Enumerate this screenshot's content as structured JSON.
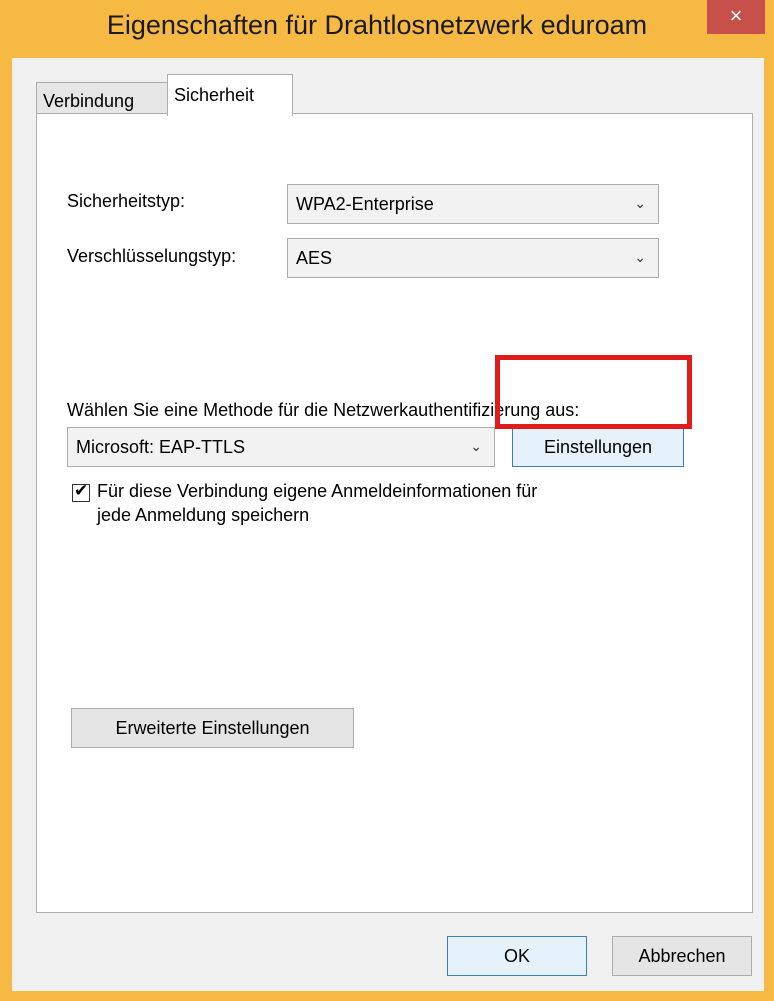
{
  "window": {
    "title": "Eigenschaften für Drahtlosnetzwerk eduroam",
    "close_label": "×"
  },
  "tabs": [
    {
      "label": "Verbindung",
      "active": false
    },
    {
      "label": "Sicherheit",
      "active": true
    }
  ],
  "security": {
    "type_label": "Sicherheitstyp:",
    "type_value": "WPA2-Enterprise",
    "encryption_label": "Verschlüsselungstyp:",
    "encryption_value": "AES"
  },
  "auth": {
    "method_label": "Wählen Sie eine Methode für die Netzwerkauthentifizierung aus:",
    "method_value": "Microsoft: EAP-TTLS",
    "settings_button": "Einstellungen",
    "remember_checked": true,
    "remember_label_line1": "Für diese Verbindung eigene Anmeldeinformationen für",
    "remember_label_line2": "jede Anmeldung speichern"
  },
  "advanced_button": "Erweiterte Einstellungen",
  "footer": {
    "ok": "OK",
    "cancel": "Abbrechen"
  },
  "colors": {
    "frame": "#f6ba44",
    "close": "#c7504b",
    "highlight": "#e11a1a"
  },
  "icons": {
    "dropdown": "chevron-down-icon",
    "check": "checkmark-icon"
  }
}
